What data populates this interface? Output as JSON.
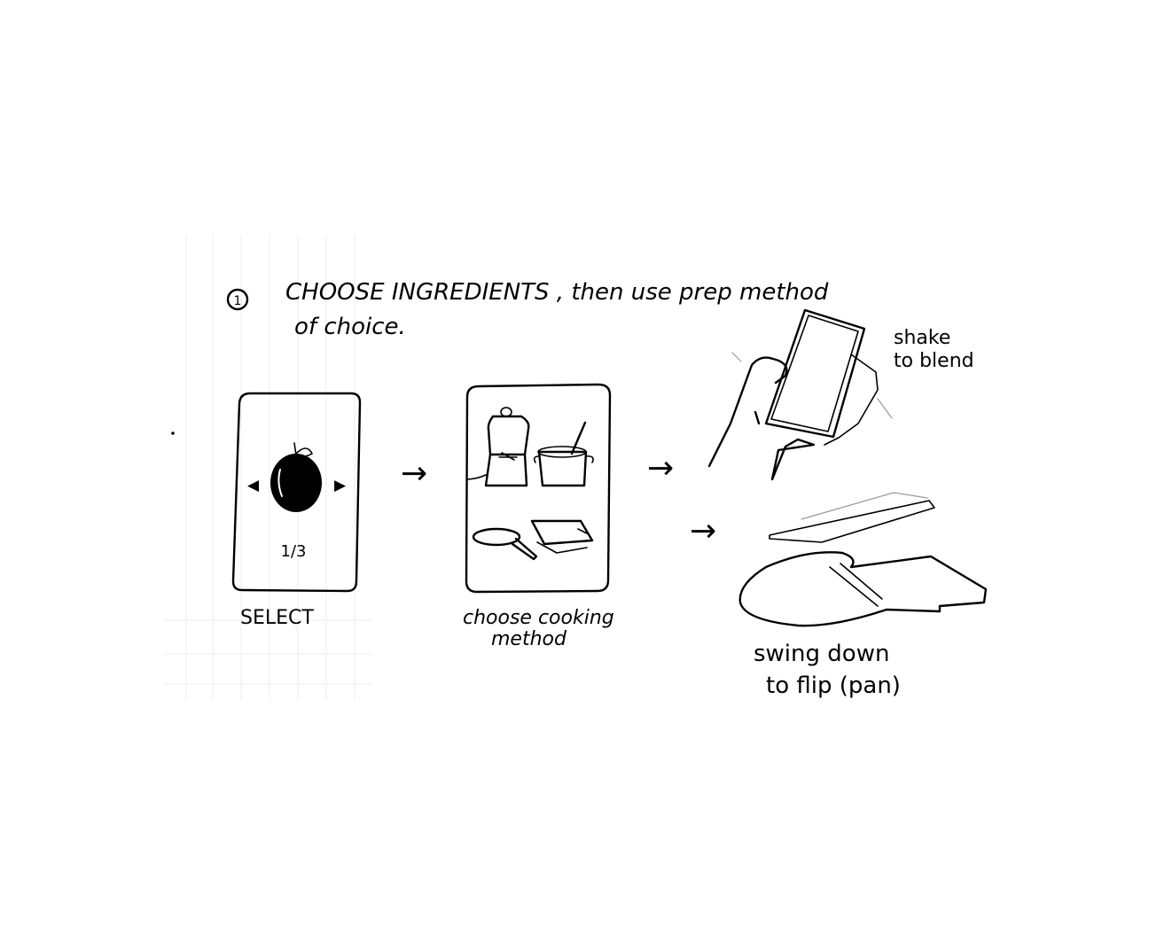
{
  "step": {
    "number": "1",
    "title_line1": "CHOOSE INGREDIENTS , then use prep method",
    "title_line2": "of choice."
  },
  "select_screen": {
    "counter": "1/3",
    "caption": "SELECT",
    "left_arrow": "◀",
    "right_arrow": "▶"
  },
  "method_screen": {
    "caption_line1": "choose cooking",
    "caption_line2": "method"
  },
  "gestures": {
    "shake_line1": "shake",
    "shake_line2": "to blend",
    "swing_line1": "swing down",
    "swing_line2": "to flip (pan)"
  },
  "arrow_glyph": "→",
  "colors": {
    "ink": "#000000",
    "paper": "#ffffff",
    "grid": "#eeeeee"
  }
}
